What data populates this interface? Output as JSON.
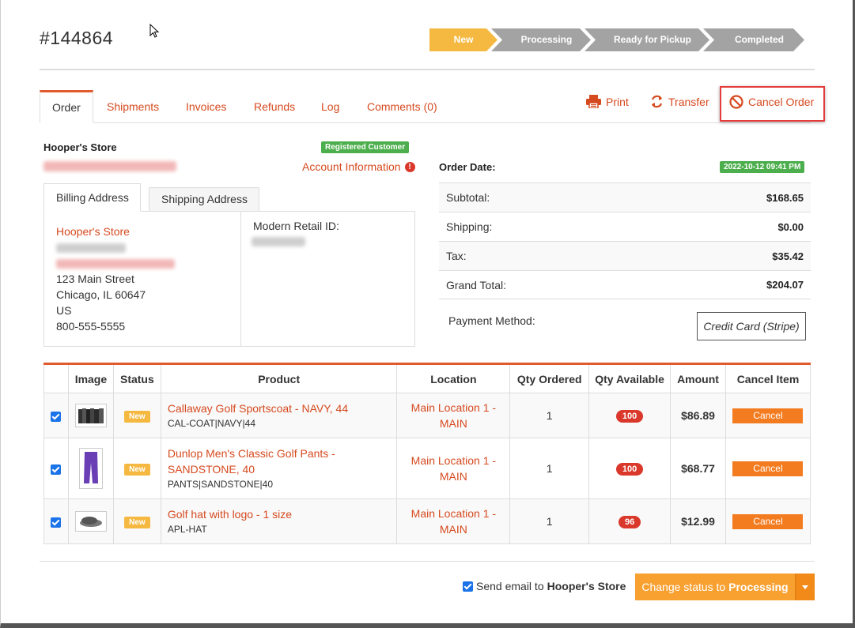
{
  "order": {
    "number": "#144864"
  },
  "steps": [
    {
      "label": "New",
      "color": "#f5b942"
    },
    {
      "label": "Processing",
      "color": "#a3a3a3"
    },
    {
      "label": "Ready for Pickup",
      "color": "#a3a3a3"
    },
    {
      "label": "Completed",
      "color": "#a3a3a3"
    }
  ],
  "tabs": [
    "Order",
    "Shipments",
    "Invoices",
    "Refunds",
    "Log",
    "Comments (0)"
  ],
  "actions": {
    "print": "Print",
    "transfer": "Transfer",
    "cancel": "Cancel Order"
  },
  "customer": {
    "store": "Hooper's Store",
    "badge": "Registered Customer",
    "account_info": "Account Information"
  },
  "address_tabs": {
    "billing": "Billing Address",
    "shipping": "Shipping Address"
  },
  "billing": {
    "name": "Hooper's Store",
    "street": "123 Main Street",
    "city": "Chicago, IL 60647",
    "country": "US",
    "phone": "800-555-5555",
    "retail_id_label": "Modern Retail ID:"
  },
  "summary": {
    "order_date_label": "Order Date:",
    "order_date": "2022-10-12 09:41 PM",
    "rows": [
      {
        "label": "Subtotal:",
        "value": "$168.65"
      },
      {
        "label": "Shipping:",
        "value": "$0.00"
      },
      {
        "label": "Tax:",
        "value": "$35.42"
      },
      {
        "label": "Grand Total:",
        "value": "$204.07"
      }
    ],
    "payment_label": "Payment Method:",
    "payment_value": "Credit Card (Stripe)"
  },
  "items_table": {
    "headers": [
      "",
      "Image",
      "Status",
      "Product",
      "Location",
      "Qty Ordered",
      "Qty Available",
      "Amount",
      "Cancel Item"
    ],
    "rows": [
      {
        "status": "New",
        "name": "Callaway Golf Sportscoat - NAVY, 44",
        "sku": "CAL-COAT|NAVY|44",
        "location": "Main Location 1 - MAIN",
        "qty_ordered": "1",
        "qty_available": "100",
        "amount": "$86.89",
        "cancel": "Cancel",
        "thumb": "coats"
      },
      {
        "status": "New",
        "name": "Dunlop Men's Classic Golf Pants - SANDSTONE, 40",
        "sku": "PANTS|SANDSTONE|40",
        "location": "Main Location 1 - MAIN",
        "qty_ordered": "1",
        "qty_available": "100",
        "amount": "$68.77",
        "cancel": "Cancel",
        "thumb": "pants"
      },
      {
        "status": "New",
        "name": "Golf hat with logo - 1 size",
        "sku": "APL-HAT",
        "location": "Main Location 1 - MAIN",
        "qty_ordered": "1",
        "qty_available": "96",
        "amount": "$12.99",
        "cancel": "Cancel",
        "thumb": "hat"
      }
    ]
  },
  "footer": {
    "send_email_prefix": "Send email to",
    "send_email_target": "Hooper's Store",
    "status_prefix": "Change status to",
    "status_target": "Processing"
  }
}
